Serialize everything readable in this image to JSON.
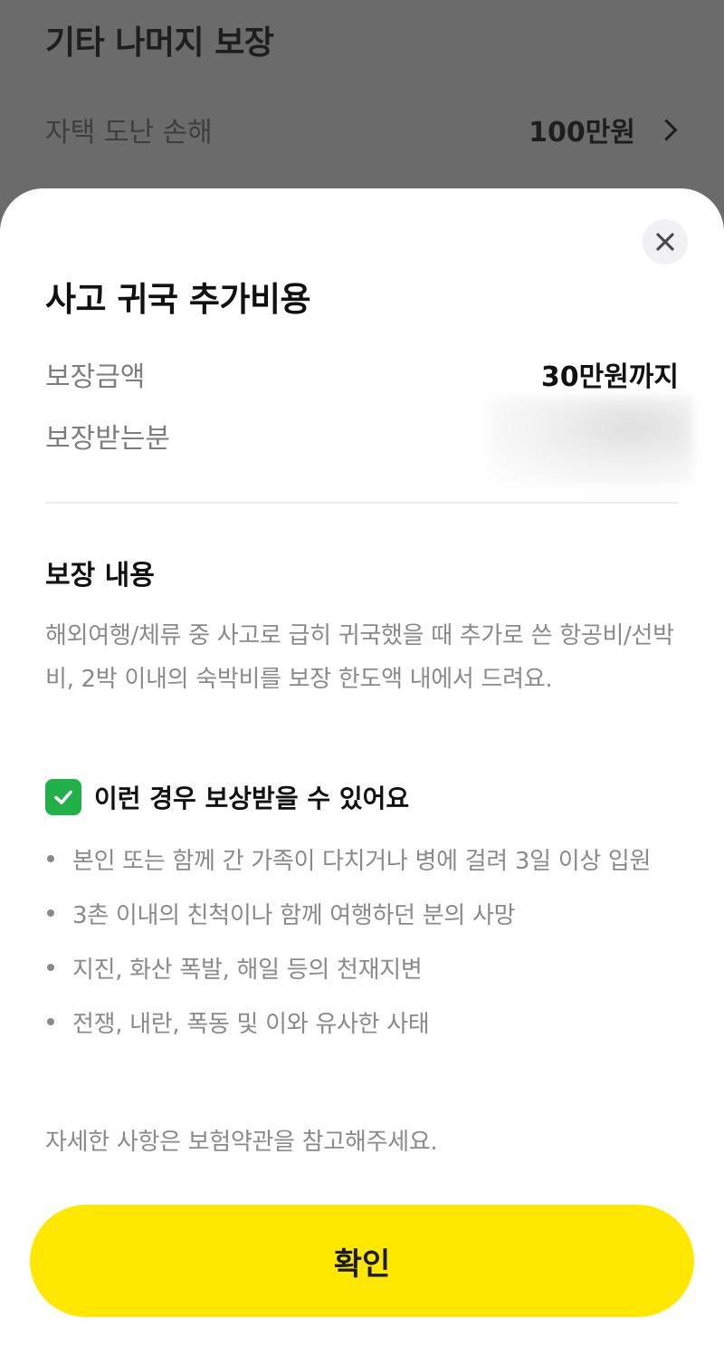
{
  "background": {
    "section_title": "기타 나머지 보장",
    "row": {
      "label": "자택 도난 손해",
      "value": "100만원"
    }
  },
  "sheet": {
    "title": "사고 귀국 추가비용",
    "info": [
      {
        "label": "보장금액",
        "value": "30만원까지"
      },
      {
        "label": "보장받는분",
        "value": ""
      }
    ],
    "section_heading": "보장 내용",
    "description": "해외여행/체류 중 사고로 급히 귀국했을 때 추가로 쓴 항공비/선박비, 2박 이내의 숙박비를 보장 한도액 내에서 드려요.",
    "eligible_title": "이런 경우 보상받을 수 있어요",
    "eligible_items": [
      "본인 또는 함께 간 가족이 다치거나 병에 걸려 3일 이상 입원",
      "3촌 이내의 친척이나 함께 여행하던 분의 사망",
      "지진, 화산 폭발, 해일 등의 천재지변",
      "전쟁, 내란, 폭동 및 이와 유사한 사태"
    ],
    "footnote": "자세한 사항은 보험약관을 참고해주세요.",
    "confirm_label": "확인"
  },
  "icons": {
    "close": "close-icon",
    "check": "check-icon",
    "chevron": "chevron-right-icon"
  },
  "colors": {
    "accent_button": "#ffe800",
    "check_green": "#22b04b",
    "overlay": "#6b6b6b"
  }
}
